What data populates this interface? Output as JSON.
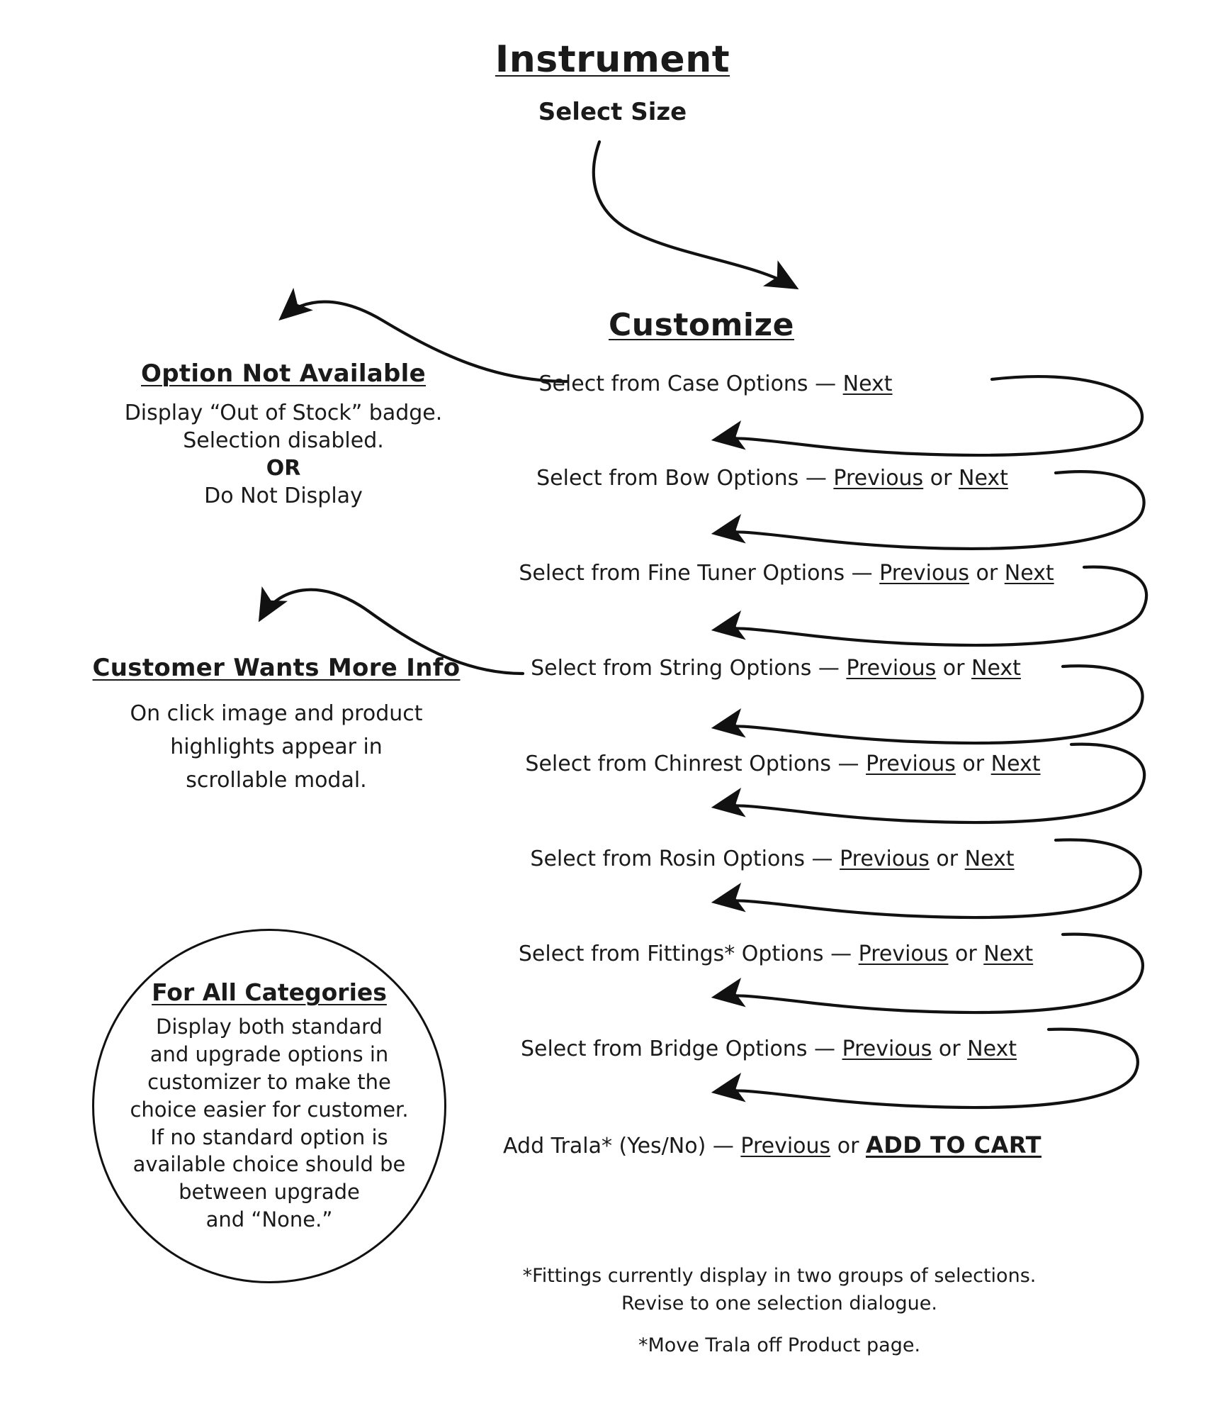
{
  "diagram": {
    "title": "Instrument",
    "subtitle": "Select Size",
    "customize_heading": "Customize",
    "steps": [
      {
        "id": "case",
        "prefix": "Select from Case Options",
        "dash": "—",
        "previous": "",
        "or": "",
        "next": "Next"
      },
      {
        "id": "bow",
        "prefix": "Select from Bow Options",
        "dash": "—",
        "previous": "Previous",
        "or": "or",
        "next": "Next"
      },
      {
        "id": "finetuner",
        "prefix": "Select from Fine Tuner Options",
        "dash": "—",
        "previous": "Previous",
        "or": "or",
        "next": "Next"
      },
      {
        "id": "string",
        "prefix": "Select from String Options",
        "dash": "—",
        "previous": "Previous",
        "or": "or",
        "next": "Next"
      },
      {
        "id": "chinrest",
        "prefix": "Select from Chinrest Options",
        "dash": "—",
        "previous": "Previous",
        "or": "or",
        "next": "Next"
      },
      {
        "id": "rosin",
        "prefix": "Select from Rosin Options",
        "dash": "—",
        "previous": "Previous",
        "or": "or",
        "next": "Next"
      },
      {
        "id": "fittings",
        "prefix": "Select from Fittings* Options",
        "dash": "—",
        "previous": "Previous",
        "or": "or",
        "next": "Next"
      },
      {
        "id": "bridge",
        "prefix": "Select from Bridge Options",
        "dash": "—",
        "previous": "Previous",
        "or": "or",
        "next": "Next"
      }
    ],
    "final_step": {
      "prefix": "Add Trala* (Yes/No)",
      "dash": "—",
      "previous": "Previous",
      "or": "or",
      "cart": "ADD TO CART"
    },
    "option_not_available": {
      "title": "Option Not Available",
      "line1": "Display “Out of Stock” badge.",
      "line2": "Selection disabled.",
      "line3": "OR",
      "line4": "Do Not Display"
    },
    "customer_more_info": {
      "title": "Customer Wants More Info",
      "line1": "On click image and product",
      "line2": "highlights appear in",
      "line3": "scrollable modal."
    },
    "all_categories": {
      "title": "For All Categories",
      "line1": "Display both standard",
      "line2": "and upgrade options in",
      "line3": "customizer to make the",
      "line4": "choice easier for customer.",
      "line5": "If no standard option is",
      "line6": "available choice should be",
      "line7": "between upgrade",
      "line8": "and “None.”"
    },
    "footnotes": {
      "note1_line1": "*Fittings currently display in two groups of selections.",
      "note1_line2": "Revise to one selection dialogue.",
      "note2": "*Move Trala off Product page."
    },
    "colors": {
      "ink": "#1a1a1a",
      "stroke": "#111111",
      "background": "#ffffff"
    }
  }
}
